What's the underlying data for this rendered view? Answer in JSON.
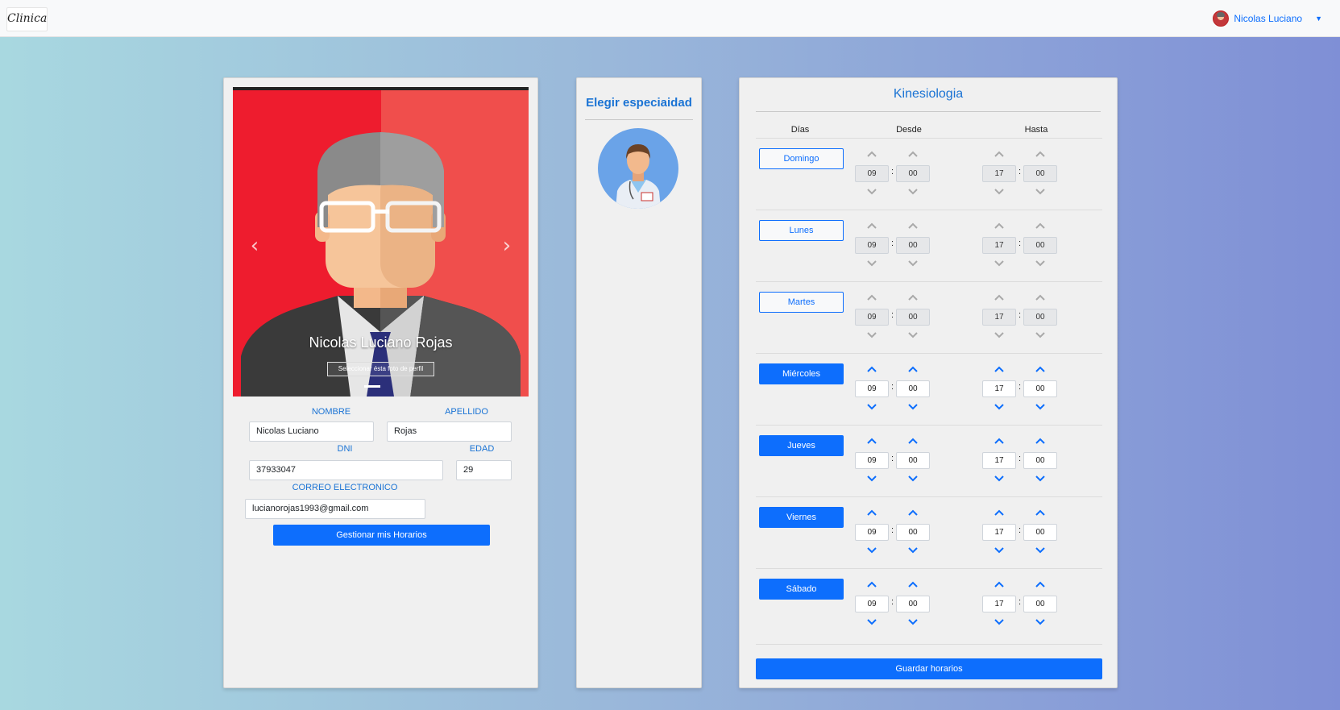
{
  "navbar": {
    "brand": "Clinica",
    "user_name": "Nicolas Luciano"
  },
  "profile": {
    "carousel": {
      "caption_name": "Nicolas Luciano Rojas",
      "caption_button": "Seleccionar ésta foto de perfil",
      "prev_icon": "chevron-left-icon",
      "next_icon": "chevron-right-icon"
    },
    "labels": {
      "nombre": "NOMBRE",
      "apellido": "APELLIDO",
      "dni": "DNI",
      "edad": "EDAD",
      "correo": "CORREO ELECTRONICO"
    },
    "values": {
      "nombre": "Nicolas Luciano",
      "apellido": "Rojas",
      "dni": "37933047",
      "edad": "29",
      "correo": "lucianorojas1993@gmail.com"
    },
    "manage_button": "Gestionar mis Horarios"
  },
  "specialty": {
    "title": "Elegir especiaidad",
    "icon": "doctor-icon"
  },
  "schedule": {
    "title": "Kinesiologia",
    "headers": {
      "dias": "Días",
      "desde": "Desde",
      "hasta": "Hasta"
    },
    "colon": ":",
    "days": [
      {
        "name": "Domingo",
        "active": false,
        "desde_h": "09",
        "desde_m": "00",
        "hasta_h": "17",
        "hasta_m": "00"
      },
      {
        "name": "Lunes",
        "active": false,
        "desde_h": "09",
        "desde_m": "00",
        "hasta_h": "17",
        "hasta_m": "00"
      },
      {
        "name": "Martes",
        "active": false,
        "desde_h": "09",
        "desde_m": "00",
        "hasta_h": "17",
        "hasta_m": "00"
      },
      {
        "name": "Miércoles",
        "active": true,
        "desde_h": "09",
        "desde_m": "00",
        "hasta_h": "17",
        "hasta_m": "00"
      },
      {
        "name": "Jueves",
        "active": true,
        "desde_h": "09",
        "desde_m": "00",
        "hasta_h": "17",
        "hasta_m": "00"
      },
      {
        "name": "Viernes",
        "active": true,
        "desde_h": "09",
        "desde_m": "00",
        "hasta_h": "17",
        "hasta_m": "00"
      },
      {
        "name": "Sábado",
        "active": true,
        "desde_h": "09",
        "desde_m": "00",
        "hasta_h": "17",
        "hasta_m": "00"
      }
    ],
    "save_button": "Guardar horarios"
  },
  "colors": {
    "primary": "#0d6efd",
    "label_blue": "#1a73d4",
    "inactive_chevron": "#a9a9a9"
  }
}
